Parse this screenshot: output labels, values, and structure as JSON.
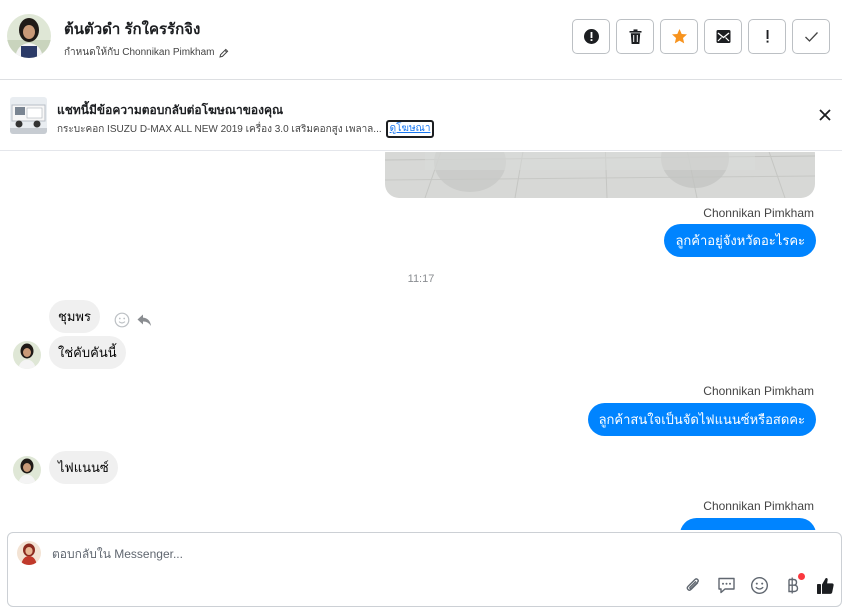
{
  "header": {
    "contact_name": "ต้นตัวดำ รักใครรักจิง",
    "assign_label": "กำหนดให้กับ Chonnikan Pimkham",
    "actions": [
      {
        "name": "mark-spam-button",
        "icon": "alert-circle-icon"
      },
      {
        "name": "delete-button",
        "icon": "trash-icon"
      },
      {
        "name": "star-button",
        "icon": "star-icon"
      },
      {
        "name": "mark-unread-button",
        "icon": "envelope-icon"
      },
      {
        "name": "follow-up-button",
        "icon": "exclamation-icon"
      },
      {
        "name": "mark-done-button",
        "icon": "check-icon"
      }
    ],
    "star_color": "#f7931e"
  },
  "ad_banner": {
    "title": "แชทนี้มีข้อความตอบกลับต่อโฆษณาของคุณ",
    "description": "กระบะคอก ISUZU D-MAX ALL NEW 2019 เครื่อง 3.0 เสริมคอกสูง เพลาล...",
    "link_label": "ดูโฆษณา"
  },
  "conversation": {
    "messages": [
      {
        "direction": "outgoing",
        "sender": "Chonnikan Pimkham",
        "text": "ลูกค้าอยู่จังหวัดอะไรคะ"
      },
      {
        "type": "timestamp",
        "text": "11:17"
      },
      {
        "direction": "incoming",
        "text": "ชุมพร"
      },
      {
        "direction": "incoming",
        "text": "ใช่คับคันนี้"
      },
      {
        "direction": "outgoing",
        "sender": "Chonnikan Pimkham",
        "text": "ลูกค้าสนใจเป็นจัดไฟแนนซ์หรือสดคะ"
      },
      {
        "direction": "incoming",
        "text": "ไฟแนนซ์"
      },
      {
        "direction": "outgoing",
        "sender": "Chonnikan Pimkham",
        "text": ""
      }
    ],
    "outgoing_color": "#0084ff",
    "incoming_color": "#f0f0f0"
  },
  "composer": {
    "placeholder": "ตอบกลับใน Messenger...",
    "tools": [
      "paperclip-icon",
      "saved-reply-icon",
      "emoji-icon",
      "baht-payment-icon",
      "thumbs-up-icon"
    ]
  }
}
